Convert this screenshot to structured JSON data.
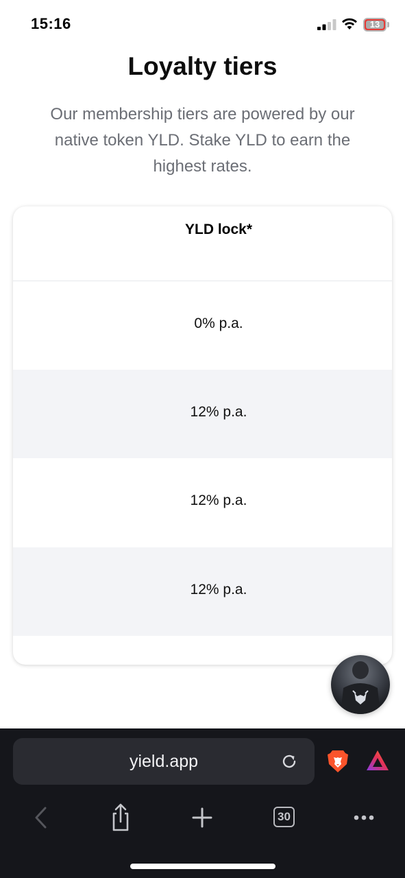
{
  "status_bar": {
    "time": "15:16",
    "battery_percent": "13",
    "icons": [
      "signal-icon",
      "wifi-icon",
      "battery-icon"
    ]
  },
  "page": {
    "title": "Loyalty tiers",
    "intro": "Our membership tiers are powered by our native token YLD. Stake YLD to earn the highest rates."
  },
  "tiers_table": {
    "column_header": "YLD lock*",
    "rows": [
      "0% p.a.",
      "12% p.a.",
      "12% p.a.",
      "12% p.a."
    ]
  },
  "chat": {
    "icon": "chat-avatar-icon"
  },
  "browser": {
    "url": "yield.app",
    "tabs_count": "30",
    "icons": [
      "reload-icon",
      "brave-lion-icon",
      "brave-rewards-icon",
      "back-icon",
      "share-icon",
      "new-tab-icon",
      "tabs-icon",
      "more-icon"
    ],
    "colors": {
      "background": "#15161b",
      "url_field": "#2a2b31",
      "brave_orange": "#fb542b"
    }
  }
}
